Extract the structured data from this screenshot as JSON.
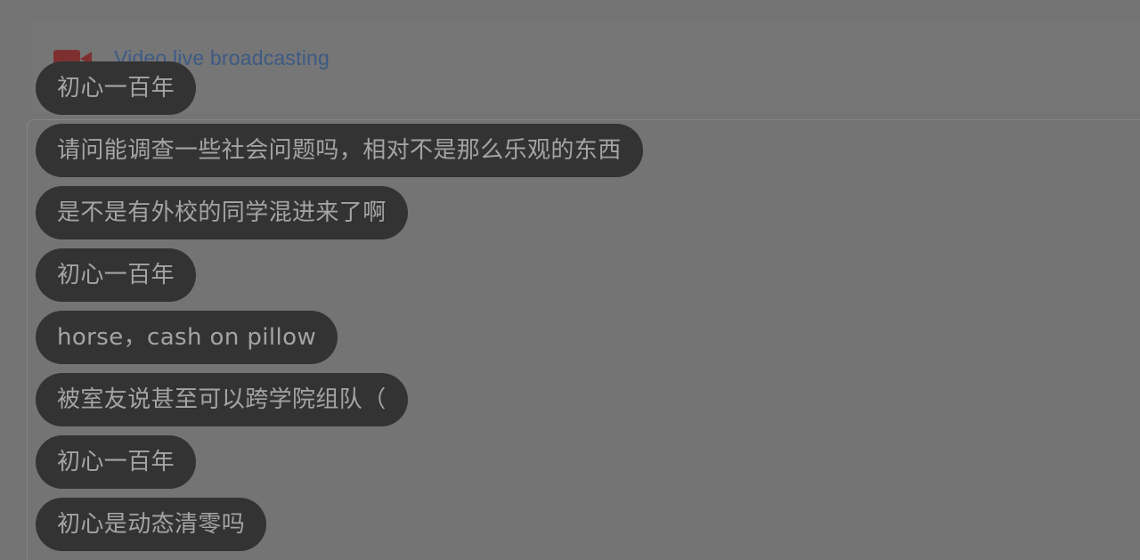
{
  "header": {
    "video_link": {
      "icon": "video-camera-icon",
      "icon_color": "#7e3030",
      "label": "Video live broadcasting",
      "label_color": "#3d5a84"
    }
  },
  "chat": {
    "bubble_background": "#333333",
    "bubble_text_color": "#a4a4a4",
    "messages": [
      {
        "text": "初心一百年"
      },
      {
        "text": "请问能调查一些社会问题吗，相对不是那么乐观的东西"
      },
      {
        "text": "是不是有外校的同学混进来了啊"
      },
      {
        "text": "初心一百年"
      },
      {
        "text": "horse，cash on pillow"
      },
      {
        "text": "被室友说甚至可以跨学院组队（"
      },
      {
        "text": "初心一百年"
      },
      {
        "text": "初心是动态清零吗"
      }
    ]
  }
}
